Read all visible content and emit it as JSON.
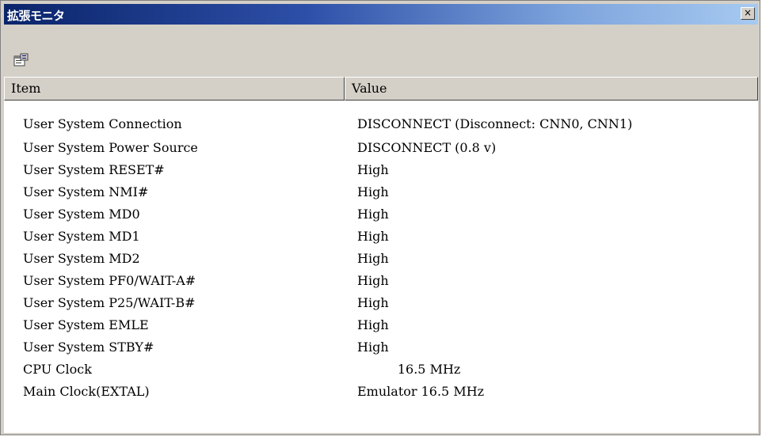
{
  "window": {
    "title": "拡張モニタ",
    "close_label": "×"
  },
  "toolbar": {
    "properties_icon": "properties-icon"
  },
  "columns": {
    "item": "Item",
    "value": "Value"
  },
  "rows": [
    {
      "item": "User System Connection",
      "value": "DISCONNECT (Disconnect: CNN0, CNN1)"
    },
    {
      "item": "User System Power Source",
      "value": "DISCONNECT (0.8 v)"
    },
    {
      "item": "User System RESET#",
      "value": "High"
    },
    {
      "item": "User System NMI#",
      "value": "High"
    },
    {
      "item": "User System MD0",
      "value": "High"
    },
    {
      "item": "User System MD1",
      "value": "High"
    },
    {
      "item": "User System MD2",
      "value": "High"
    },
    {
      "item": "User System PF0/WAIT-A#",
      "value": "High"
    },
    {
      "item": "User System P25/WAIT-B#",
      "value": "High"
    },
    {
      "item": "User System EMLE",
      "value": "High"
    },
    {
      "item": "User System STBY#",
      "value": "High"
    },
    {
      "item": "CPU Clock",
      "value": "          16.5 MHz"
    },
    {
      "item": "Main Clock(EXTAL)",
      "value": "Emulator 16.5 MHz"
    }
  ]
}
